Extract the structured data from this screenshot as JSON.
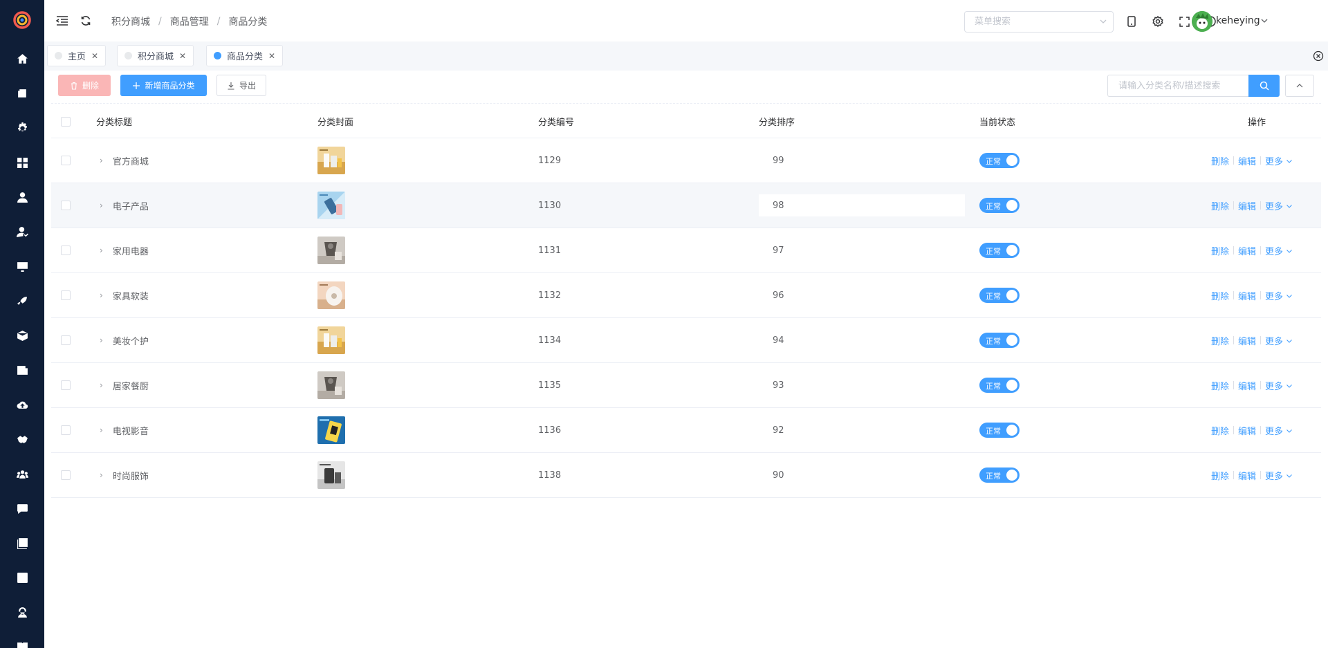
{
  "header": {
    "breadcrumb": [
      "积分商城",
      "商品管理",
      "商品分类"
    ],
    "menu_search_placeholder": "菜单搜索",
    "username": "keheying"
  },
  "tags": [
    {
      "label": "主页",
      "active": false
    },
    {
      "label": "积分商城",
      "active": false
    },
    {
      "label": "商品分类",
      "active": true
    }
  ],
  "toolbar": {
    "delete_label": "删除",
    "add_label": "新增商品分类",
    "export_label": "导出",
    "search_placeholder": "请输入分类名称/描述搜索"
  },
  "table": {
    "columns": [
      "分类标题",
      "分类封面",
      "分类编号",
      "分类排序",
      "当前状态",
      "操作"
    ],
    "rows": [
      {
        "title": "官方商城",
        "cover": "cover-boxes-yellow",
        "code": "1129",
        "sort": "99",
        "status": "正常"
      },
      {
        "title": "电子产品",
        "cover": "cover-phone-blue",
        "code": "1130",
        "sort": "98",
        "status": "正常"
      },
      {
        "title": "家用电器",
        "cover": "cover-appliance-grey",
        "code": "1131",
        "sort": "97",
        "status": "正常"
      },
      {
        "title": "家具软装",
        "cover": "cover-speaker-peach",
        "code": "1132",
        "sort": "96",
        "status": "正常"
      },
      {
        "title": "美妆个护",
        "cover": "cover-boxes-yellow",
        "code": "1134",
        "sort": "94",
        "status": "正常"
      },
      {
        "title": "居家餐厨",
        "cover": "cover-appliance-grey",
        "code": "1135",
        "sort": "93",
        "status": "正常"
      },
      {
        "title": "电视影音",
        "cover": "cover-device-blue",
        "code": "1136",
        "sort": "92",
        "status": "正常"
      },
      {
        "title": "时尚服饰",
        "cover": "cover-device-dark",
        "code": "1138",
        "sort": "90",
        "status": "正常"
      }
    ],
    "ops": {
      "delete": "删除",
      "edit": "编辑",
      "more": "更多"
    }
  },
  "colors": {
    "sidebar": "#0f1e37",
    "primary": "#409eff",
    "danger_light": "#fab6b6"
  },
  "sidebar_icons": [
    "home-icon",
    "wallet-icon",
    "settings-icon",
    "apps-icon",
    "user-icon",
    "user-check-icon",
    "monitor-icon",
    "rocket-icon",
    "cube-icon",
    "news-icon",
    "cloud-upload-icon",
    "handshake-icon",
    "team-icon",
    "chat-icon",
    "gallery-icon",
    "template-icon",
    "support-icon",
    "book-icon"
  ]
}
